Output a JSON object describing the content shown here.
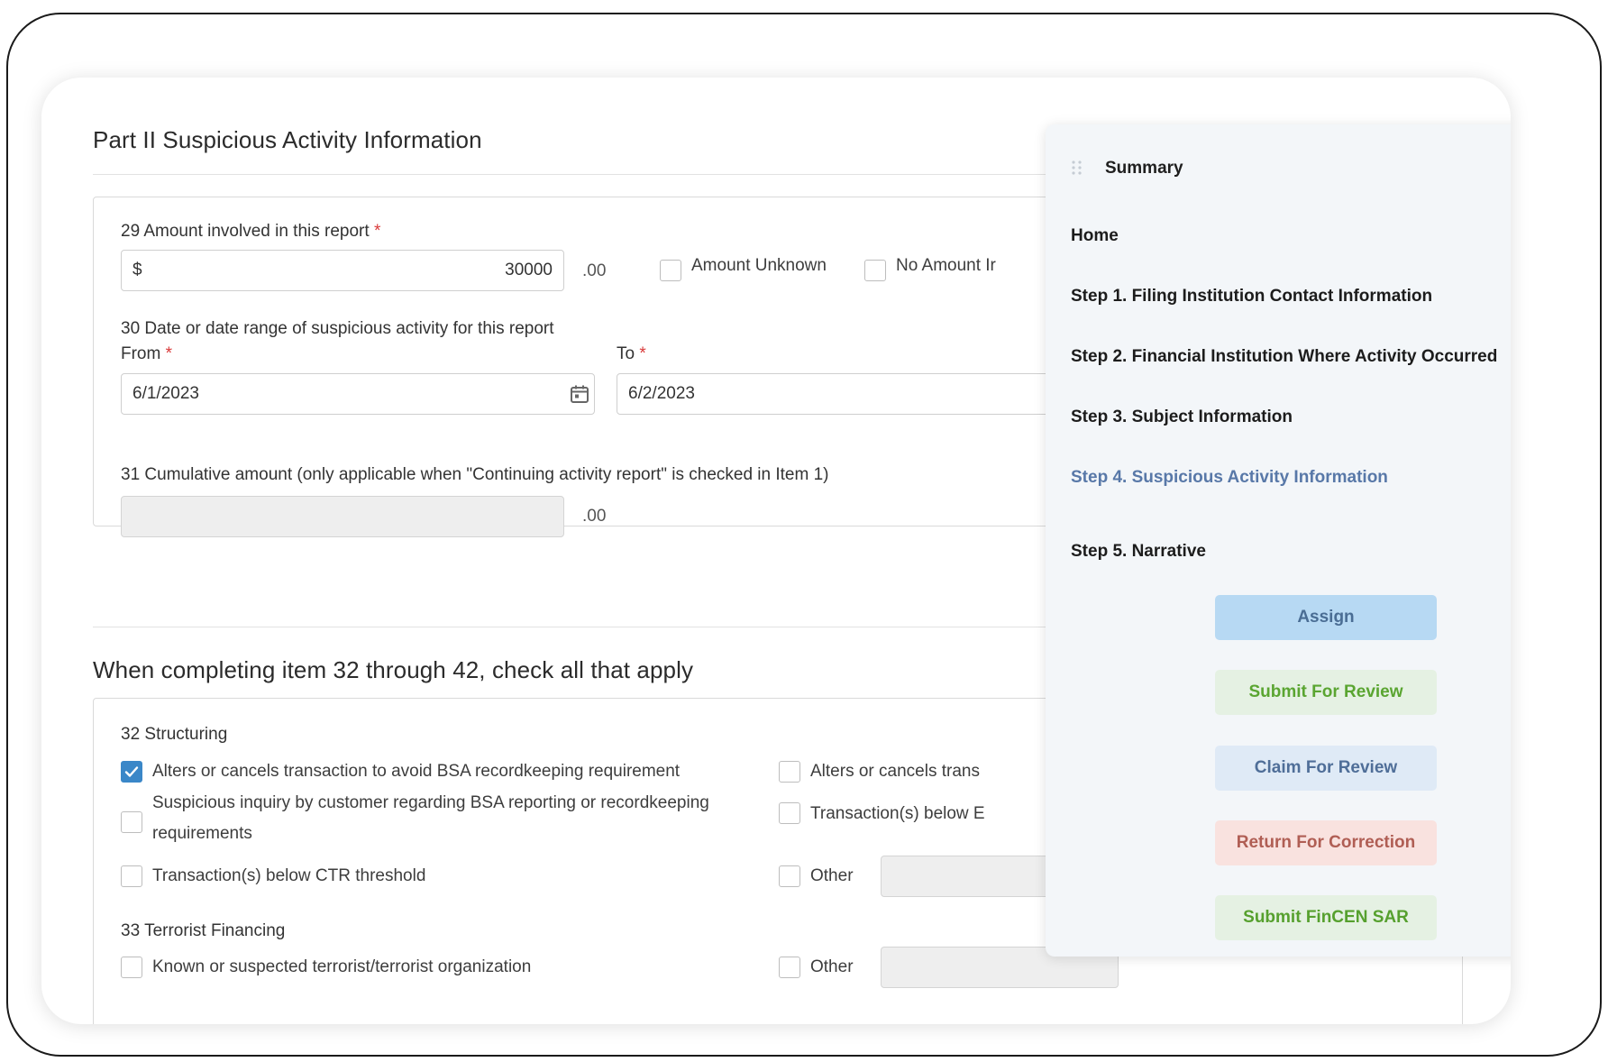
{
  "part2": {
    "title": "Part II Suspicious Activity Information",
    "item29": {
      "label": "29 Amount involved in this report",
      "required": "*",
      "currency": "$",
      "value": "30000",
      "cents": ".00",
      "unknown_label": "Amount Unknown",
      "no_amount_label": "No Amount Ir"
    },
    "item30": {
      "label": "30 Date or date range of suspicious activity for this report",
      "from_label": "From",
      "to_label": "To",
      "required": "*",
      "from_value": "6/1/2023",
      "to_value": "6/2/2023"
    },
    "item31": {
      "label": "31 Cumulative amount (only applicable when \"Continuing activity report\" is checked in Item 1)",
      "value": "",
      "cents": ".00"
    }
  },
  "checks": {
    "title": "When completing item 32 through 42, check all that apply",
    "item32": {
      "label": "32 Structuring",
      "left": [
        {
          "label": "Alters or cancels transaction to avoid BSA recordkeeping requirement",
          "checked": true
        },
        {
          "label_line1": "Suspicious inquiry by customer regarding BSA reporting or recordkeeping",
          "label_line2": "requirements",
          "checked": false
        },
        {
          "label": "Transaction(s) below CTR threshold",
          "checked": false
        }
      ],
      "right": [
        {
          "label": "Alters or cancels trans",
          "checked": false
        },
        {
          "label": "Transaction(s) below E",
          "checked": false
        },
        {
          "label": "Other",
          "checked": false
        }
      ]
    },
    "item33": {
      "label": "33 Terrorist Financing",
      "left": [
        {
          "label": "Known or suspected terrorist/terrorist organization",
          "checked": false
        }
      ],
      "right": [
        {
          "label": "Other",
          "checked": false
        }
      ]
    }
  },
  "summary": {
    "title": "Summary",
    "steps": [
      {
        "label": "Home",
        "status": "complete"
      },
      {
        "label": "Step 1. Filing Institution Contact Information",
        "status": "complete"
      },
      {
        "label": "Step 2. Financial Institution Where Activity Occurred",
        "status": "complete"
      },
      {
        "label": "Step 3. Subject Information",
        "status": "error"
      },
      {
        "label": "Step 4. Suspicious Activity Information",
        "status": "complete"
      },
      {
        "label": "Step 5. Narrative",
        "status": "complete"
      }
    ],
    "buttons": {
      "assign": "Assign",
      "submit_review": "Submit For Review",
      "claim_review": "Claim For Review",
      "return_correction": "Return For Correction",
      "submit_fincen": "Submit FinCEN SAR"
    },
    "error_glyph": "!"
  },
  "colors": {
    "success": "#56b75a",
    "error": "#ef5a5a",
    "active_step": "#5878a8",
    "checkbox_checked": "#3a87c8"
  }
}
